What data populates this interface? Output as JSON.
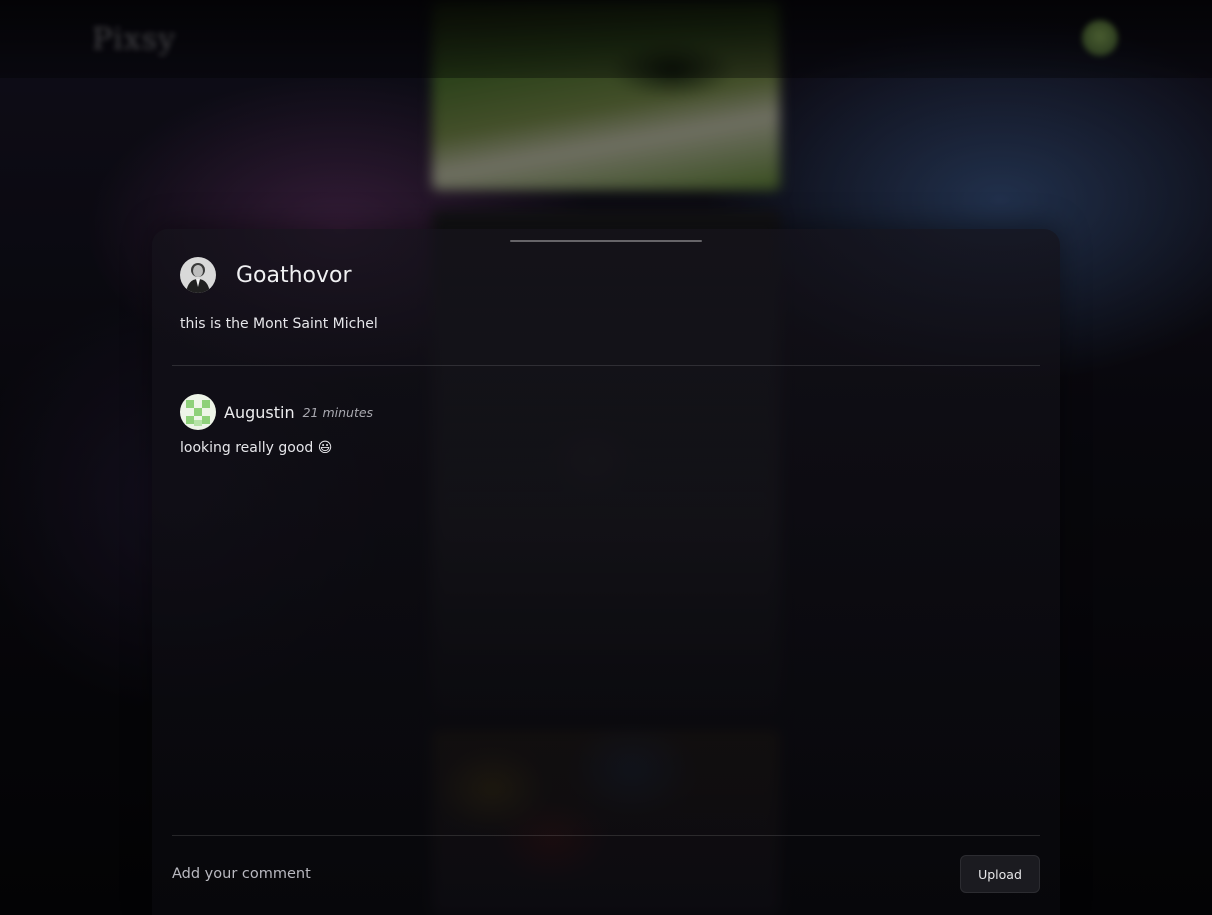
{
  "background": {
    "logo_text": "Pixsy"
  },
  "post": {
    "author": {
      "name": "Goathovor",
      "avatar_icon": "avatar-portrait-photo"
    },
    "caption": "this is the Mont Saint Michel"
  },
  "comments": [
    {
      "author": "Augustin",
      "avatar_icon": "identicon-green",
      "time": "21 minutes",
      "text": "looking really good 😃"
    }
  ],
  "composer": {
    "placeholder": "Add your comment",
    "upload_label": "Upload"
  },
  "colors": {
    "identicon": "#8fd17a",
    "sheet_bg": "#0c0b12"
  }
}
